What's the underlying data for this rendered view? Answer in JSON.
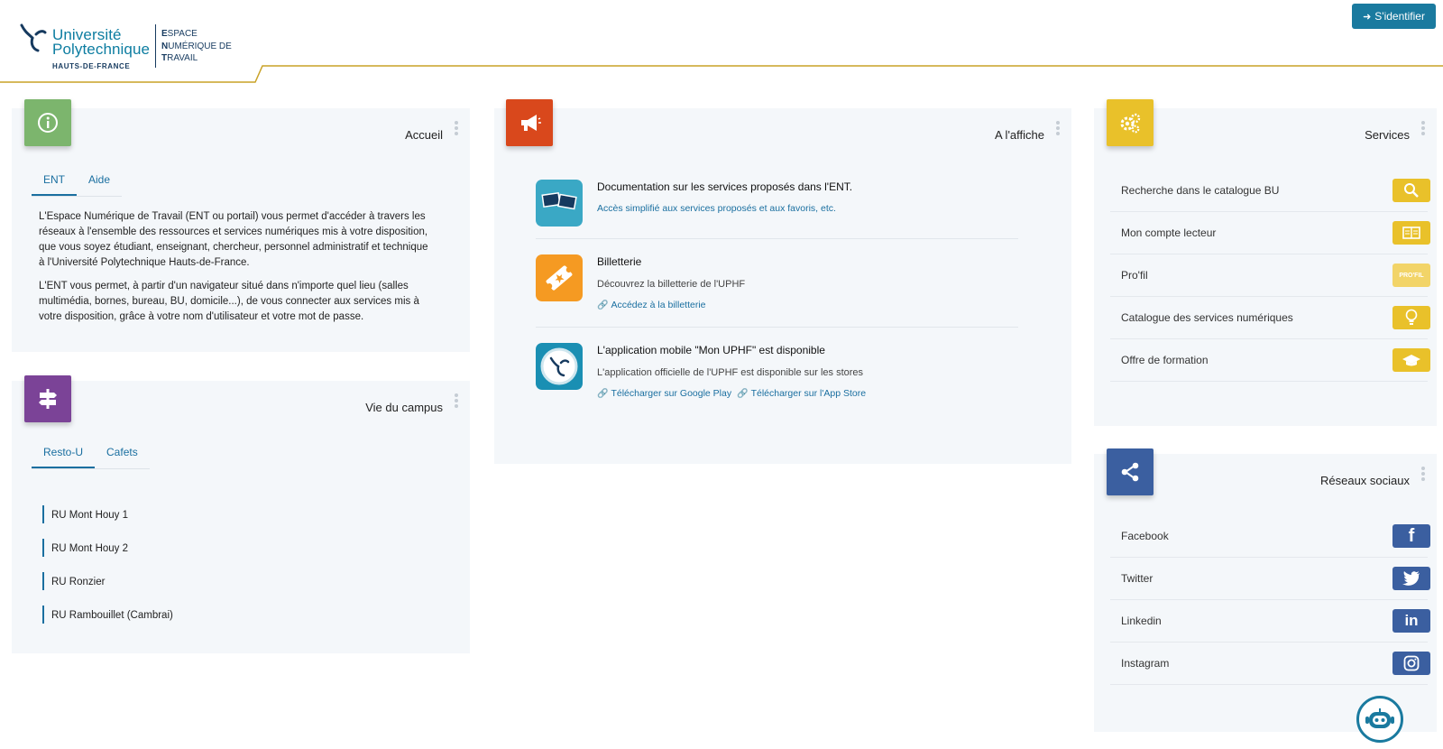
{
  "header": {
    "logo": {
      "name_line1": "Université",
      "name_line2": "Polytechnique",
      "region": "HAUTS-DE-FRANCE",
      "ent_lines": [
        {
          "first": "E",
          "rest": "SPACE"
        },
        {
          "first": "N",
          "rest": "UMÉRIQUE DE"
        },
        {
          "first": "T",
          "rest": "RAVAIL"
        }
      ]
    },
    "login_label": "S'identifier",
    "accent_color": "#c9a227"
  },
  "accueil": {
    "title": "Accueil",
    "tabs": [
      "ENT",
      "Aide"
    ],
    "active_tab": "ENT",
    "paragraphs": [
      "L'Espace Numérique de Travail (ENT ou portail) vous permet d'accéder à travers les réseaux à l'ensemble des ressources et services numériques mis à votre disposition, que vous soyez étudiant, enseignant, chercheur, personnel administratif et technique à l'Université Polytechnique Hauts-de-France.",
      "L'ENT vous permet, à partir d'un navigateur situé dans n'importe quel lieu (salles multimédia, bornes, bureau, BU, domicile...), de vous connecter aux services mis à votre disposition, grâce à votre nom d'utilisateur et votre mot de passe."
    ],
    "badge_color": "#7cb56d",
    "icon": "info-icon"
  },
  "campus": {
    "title": "Vie du campus",
    "tabs": [
      "Resto-U",
      "Cafets"
    ],
    "active_tab": "Resto-U",
    "items": [
      "RU Mont Houy 1",
      "RU Mont Houy 2",
      "RU Ronzier",
      "RU Rambouillet (Cambrai)"
    ],
    "badge_color": "#7b4397",
    "icon": "signpost-icon"
  },
  "affiche": {
    "title": "A l'affiche",
    "badge_color": "#d9481c",
    "icon": "megaphone-icon",
    "items": [
      {
        "title": "Documentation sur les services proposés dans l'ENT.",
        "link_text": "Accès simplifié aux services proposés et aux favoris, etc.",
        "icon": "documentation-icon"
      },
      {
        "title": "Billetterie",
        "desc": "Découvrez la billetterie de l'UPHF",
        "links": [
          "Accédez à la billetterie"
        ],
        "icon": "ticket-icon"
      },
      {
        "title": "L'application mobile \"Mon UPHF\" est disponible",
        "desc": "L'application officielle de l'UPHF est disponible sur les stores",
        "links": [
          "Télécharger sur Google Play",
          "Télécharger sur l'App Store"
        ],
        "icon": "mobile-app-icon"
      }
    ]
  },
  "services": {
    "title": "Services",
    "badge_color": "#e9c12a",
    "icon": "gears-icon",
    "items": [
      {
        "label": "Recherche dans le catalogue BU",
        "icon": "search-icon"
      },
      {
        "label": "Mon compte lecteur",
        "icon": "book-icon"
      },
      {
        "label": "Pro'fil",
        "icon": "profil-icon",
        "icon_text": "PRO'FIL"
      },
      {
        "label": "Catalogue des services numériques",
        "icon": "lightbulb-icon"
      },
      {
        "label": "Offre de formation",
        "icon": "graduation-cap-icon"
      }
    ]
  },
  "social": {
    "title": "Réseaux sociaux",
    "badge_color": "#3b5fa0",
    "icon": "share-icon",
    "items": [
      {
        "label": "Facebook",
        "icon": "facebook-icon"
      },
      {
        "label": "Twitter",
        "icon": "twitter-icon"
      },
      {
        "label": "Linkedin",
        "icon": "linkedin-icon"
      },
      {
        "label": "Instagram",
        "icon": "instagram-icon"
      }
    ]
  }
}
